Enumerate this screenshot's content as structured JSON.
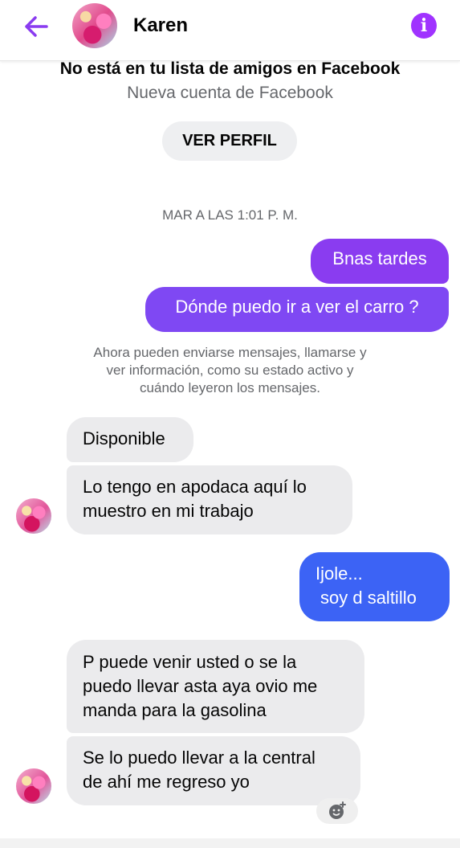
{
  "header": {
    "name": "Karen",
    "back_icon": "arrow-left-icon",
    "info_icon": "info-icon",
    "info_glyph": "i",
    "accent_color": "#a033ff"
  },
  "notice": {
    "title": "No está en tu lista de amigos en Facebook",
    "subtitle": "Nueva cuenta de Facebook",
    "profile_button": "VER PERFIL"
  },
  "timestamp": "MAR A LAS 1:01 P. M.",
  "messages": {
    "m1": "Bnas tardes",
    "m2": "Dónde puedo ir a ver el carro ?",
    "m3": "Disponible",
    "m4_line1": "Lo tengo en apodaca aquí lo",
    "m4_line2": "muestro en mi trabajo",
    "m5_line1": "Ijole...",
    "m5_line2": "soy d saltillo",
    "m6_line1": "P puede venir usted o se la",
    "m6_line2": "puedo llevar asta aya ovio me",
    "m6_line3": "manda para la gasolina",
    "m7_line1": "Se lo puedo llevar a la central",
    "m7_line2": "de ahí me regreso yo"
  },
  "system_note": {
    "line1": "Ahora pueden enviarse mensajes, llamarse y",
    "line2": "ver información, como su estado activo y",
    "line3": "cuándo leyeron los mensajes."
  },
  "colors": {
    "outgoing_purple": "#8a3cf0",
    "outgoing_blue": "#3c63f5",
    "incoming_gray": "#ebebed"
  },
  "reaction_icon": "add-reaction-icon"
}
